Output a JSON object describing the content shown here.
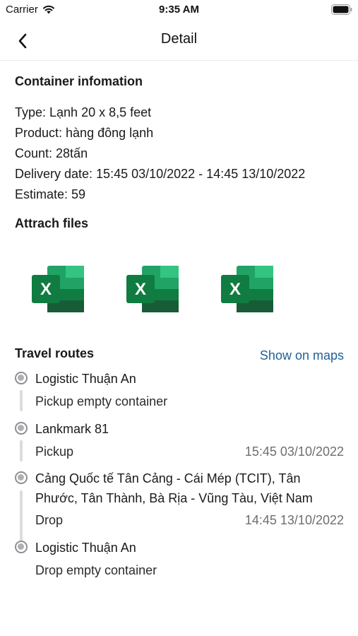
{
  "status": {
    "carrier": "Carrier",
    "time": "9:35 AM"
  },
  "nav": {
    "title": "Detail"
  },
  "container": {
    "section_title": "Container infomation",
    "lines": [
      "Type: Lạnh 20 x 8,5 feet",
      "Product: hàng đông lạnh",
      "Count: 28tấn",
      "Delivery date: 15:45 03/10/2022 - 14:45 13/10/2022",
      "Estimate: 59"
    ]
  },
  "files": {
    "section_title": "Attrach files",
    "items": [
      {
        "icon": "excel-file-icon",
        "letter": "X"
      },
      {
        "icon": "excel-file-icon",
        "letter": "X"
      },
      {
        "icon": "excel-file-icon",
        "letter": "X"
      }
    ]
  },
  "routes": {
    "section_title": "Travel routes",
    "show_maps_label": "Show on maps",
    "stops": [
      {
        "name": "Logistic Thuận An",
        "sub": "Pickup empty container",
        "time": ""
      },
      {
        "name": "Lankmark 81",
        "sub": "Pickup",
        "time": "15:45 03/10/2022"
      },
      {
        "name_lines": [
          "Cảng Quốc tế Tân Cảng - Cái Mép (TCIT), Tân",
          "Phước, Tân Thành, Bà Rịa - Vũng Tàu, Việt Nam"
        ],
        "sub": "Drop",
        "time": "14:45 13/10/2022"
      },
      {
        "name": "Logistic Thuận An",
        "sub": "Drop empty container",
        "time": ""
      }
    ]
  },
  "colors": {
    "excel_dark": "#185c37",
    "excel_mid": "#21a366",
    "excel_light": "#33c481",
    "link": "#1f5f99"
  }
}
